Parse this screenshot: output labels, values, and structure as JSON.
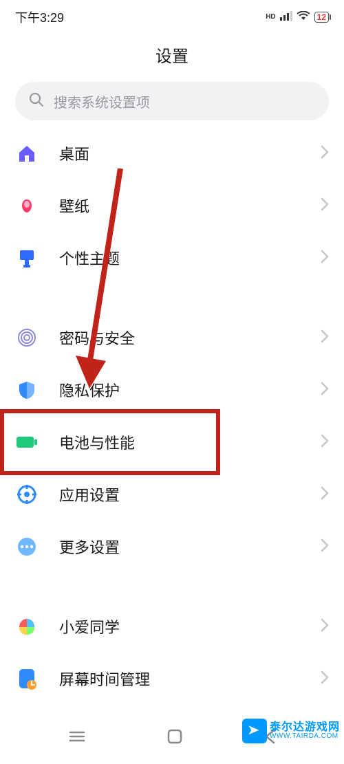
{
  "status": {
    "time": "下午3:29",
    "hd": "HD",
    "battery": "12"
  },
  "page": {
    "title": "设置"
  },
  "search": {
    "placeholder": "搜索系统设置项"
  },
  "group1": [
    {
      "icon": "home",
      "icon_color": "#6b5cff",
      "label": "桌面"
    },
    {
      "icon": "wallpaper",
      "icon_color": "#ff3b6b",
      "label": "壁纸"
    },
    {
      "icon": "theme",
      "icon_color": "#2f6bff",
      "label": "个性主题"
    }
  ],
  "group2": [
    {
      "icon": "fingerprint",
      "icon_color": "#8a8ad6",
      "label": "密码与安全"
    },
    {
      "icon": "privacy",
      "icon_color": "#2f8cff",
      "label": "隐私保护"
    },
    {
      "icon": "battery",
      "icon_color": "#1fc97a",
      "label": "电池与性能",
      "highlight": true
    },
    {
      "icon": "apps",
      "icon_color": "#2f8cff",
      "label": "应用设置"
    },
    {
      "icon": "more",
      "icon_color": "#6fb7ff",
      "label": "更多设置"
    }
  ],
  "group3": [
    {
      "icon": "xiaoai",
      "icon_color": "multi",
      "label": "小爱同学"
    },
    {
      "icon": "screentime",
      "icon_color": "#2f8cff",
      "label": "屏幕时间管理"
    }
  ],
  "watermark": {
    "name_cn": "泰尔达游戏网",
    "name_en": "WWW.TAIRDA.COM"
  },
  "annotation": {
    "arrow_target_label": "电池与性能"
  }
}
